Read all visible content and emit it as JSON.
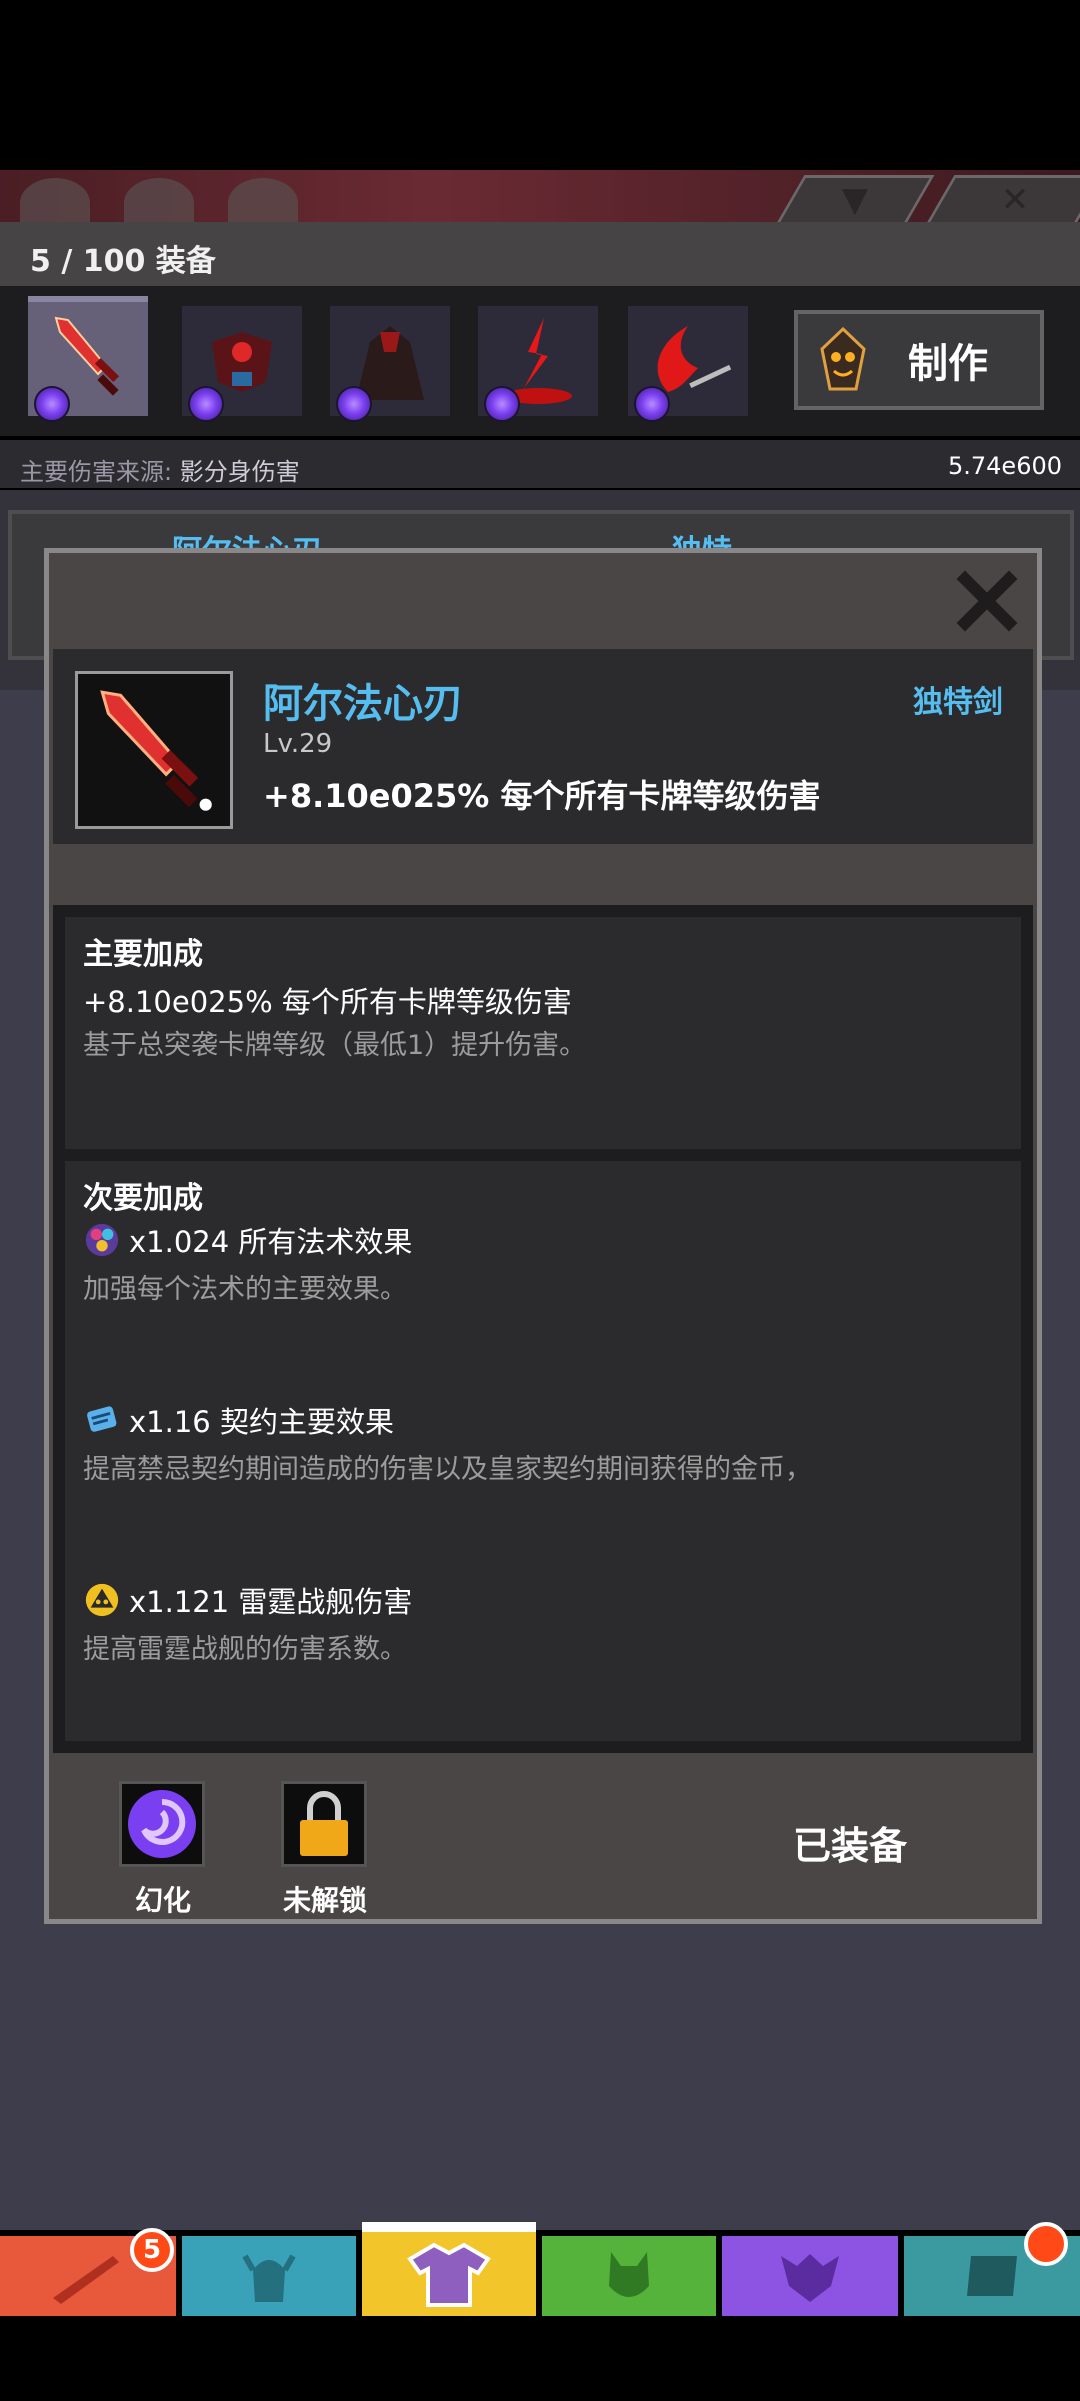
{
  "header": {
    "equip_count": "5 / 100 装备",
    "craft_label": "制作"
  },
  "damage_source": {
    "label": "主要伤害来源:",
    "value_name": "影分身伤害",
    "value_number": "5.74e600"
  },
  "item": {
    "name": "阿尔法心刃",
    "level": "Lv.29",
    "type": "独特剑",
    "effect": "+8.10e025% 每个所有卡牌等级伤害"
  },
  "primary": {
    "title": "主要加成",
    "line": "+8.10e025% 每个所有卡牌等级伤害",
    "desc": "基于总突袭卡牌等级（最低1）提升伤害。"
  },
  "secondary": {
    "title": "次要加成",
    "items": [
      {
        "icon": "spell-gem-icon",
        "line": "x1.024 所有法术效果",
        "desc": "加强每个法术的主要效果。"
      },
      {
        "icon": "scroll-icon",
        "line": "x1.16 契约主要效果",
        "desc": "提高禁忌契约期间造成的伤害以及皇家契约期间获得的金币，"
      },
      {
        "icon": "thunder-ship-icon",
        "line": "x1.121 雷霆战舰伤害",
        "desc": "提高雷霆战舰的伤害系数。"
      }
    ]
  },
  "actions": {
    "transmog_label": "幻化",
    "locked_label": "未解锁",
    "status": "已装备"
  },
  "nav": {
    "badge_count": "5",
    "colors": [
      "#e8583a",
      "#3aa2b8",
      "#f2c62b",
      "#55b33c",
      "#8d54e3",
      "#3b9aa0"
    ]
  },
  "background_card": {
    "name": "阿尔法心刃",
    "type": "独特"
  }
}
